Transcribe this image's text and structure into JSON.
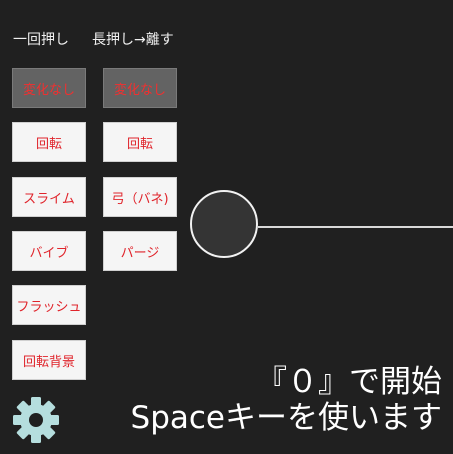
{
  "header": {
    "short_press_label": "一回押し",
    "long_press_label": "長押し→離す"
  },
  "short_press_buttons": [
    {
      "label": "変化なし",
      "selected": true
    },
    {
      "label": "回転"
    },
    {
      "label": "スライム"
    },
    {
      "label": "バイブ"
    },
    {
      "label": "フラッシュ"
    },
    {
      "label": "回転背景"
    }
  ],
  "long_press_buttons": [
    {
      "label": "変化なし",
      "selected": true
    },
    {
      "label": "回転"
    },
    {
      "label": "弓（バネ)"
    },
    {
      "label": "パージ"
    }
  ],
  "instructions": {
    "line1": "『０』で開始",
    "line2": "Spaceキーを使います"
  },
  "colors": {
    "background": "#202020",
    "button_text": "#e0242b",
    "selected_button_bg": "#636363",
    "gear": "#b5dede"
  },
  "icons": {
    "settings": "gear-icon"
  }
}
